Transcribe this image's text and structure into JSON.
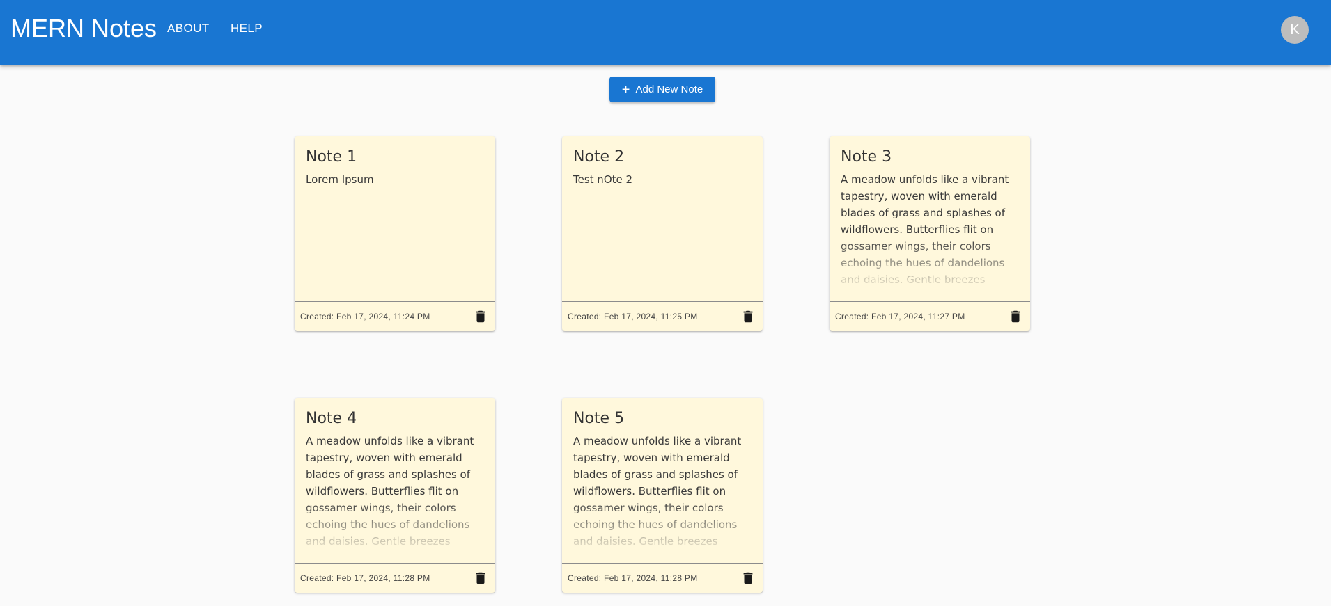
{
  "appbar": {
    "title": "MERN Notes",
    "nav": [
      {
        "label": "ABOUT"
      },
      {
        "label": "HELP"
      }
    ],
    "avatar_initial": "K",
    "color": "#1976d2"
  },
  "toolbar": {
    "add_note_label": "Add New Note",
    "add_icon": "plus-icon"
  },
  "notes": [
    {
      "title": "Note 1",
      "body": "Lorem Ipsum",
      "created": "Created: Feb 17, 2024, 11:24 PM"
    },
    {
      "title": "Note 2",
      "body": "Test nOte 2",
      "created": "Created: Feb 17, 2024, 11:25 PM"
    },
    {
      "title": "Note 3",
      "body": "A meadow unfolds like a vibrant tapestry, woven with emerald blades of grass and splashes of wildflowers. Butterflies flit on gossamer wings, their colors echoing the hues of dandelions and daisies. Gentle breezes",
      "created": "Created: Feb 17, 2024, 11:27 PM"
    },
    {
      "title": "Note 4",
      "body": "A meadow unfolds like a vibrant tapestry, woven with emerald blades of grass and splashes of wildflowers. Butterflies flit on gossamer wings, their colors echoing the hues of dandelions and daisies. Gentle breezes",
      "created": "Created: Feb 17, 2024, 11:28 PM"
    },
    {
      "title": "Note 5",
      "body": "A meadow unfolds like a vibrant tapestry, woven with emerald blades of grass and splashes of wildflowers. Butterflies flit on gossamer wings, their colors echoing the hues of dandelions and daisies. Gentle breezes",
      "created": "Created: Feb 17, 2024, 11:28 PM"
    }
  ],
  "colors": {
    "card_background": "#fff8dc",
    "page_background": "#fafafa",
    "accent": "#1976d2"
  }
}
